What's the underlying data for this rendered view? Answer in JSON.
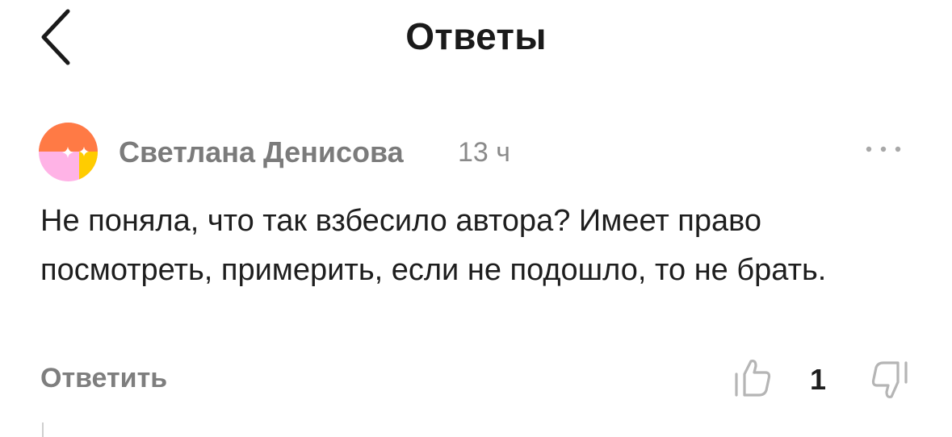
{
  "header": {
    "title": "Ответы",
    "back_icon": "chevron-left-icon"
  },
  "comment": {
    "author": "Светлана Денисова",
    "time": "13 ч",
    "text": "Не поняла, что так взбесило автора? Имеет право посмотреть, примерить, если не подошло, то не брать.",
    "reply_label": "Ответить",
    "likes": "1",
    "icons": {
      "more": "more-dots-icon",
      "like": "thumbs-up-icon",
      "dislike": "thumbs-down-icon"
    }
  },
  "colors": {
    "avatar_orange": "#ff7a45",
    "avatar_pink": "#ffb3e6",
    "avatar_yellow": "#ffcc00",
    "muted_text": "#7b7b7b",
    "body_text": "#1e1e1e"
  }
}
